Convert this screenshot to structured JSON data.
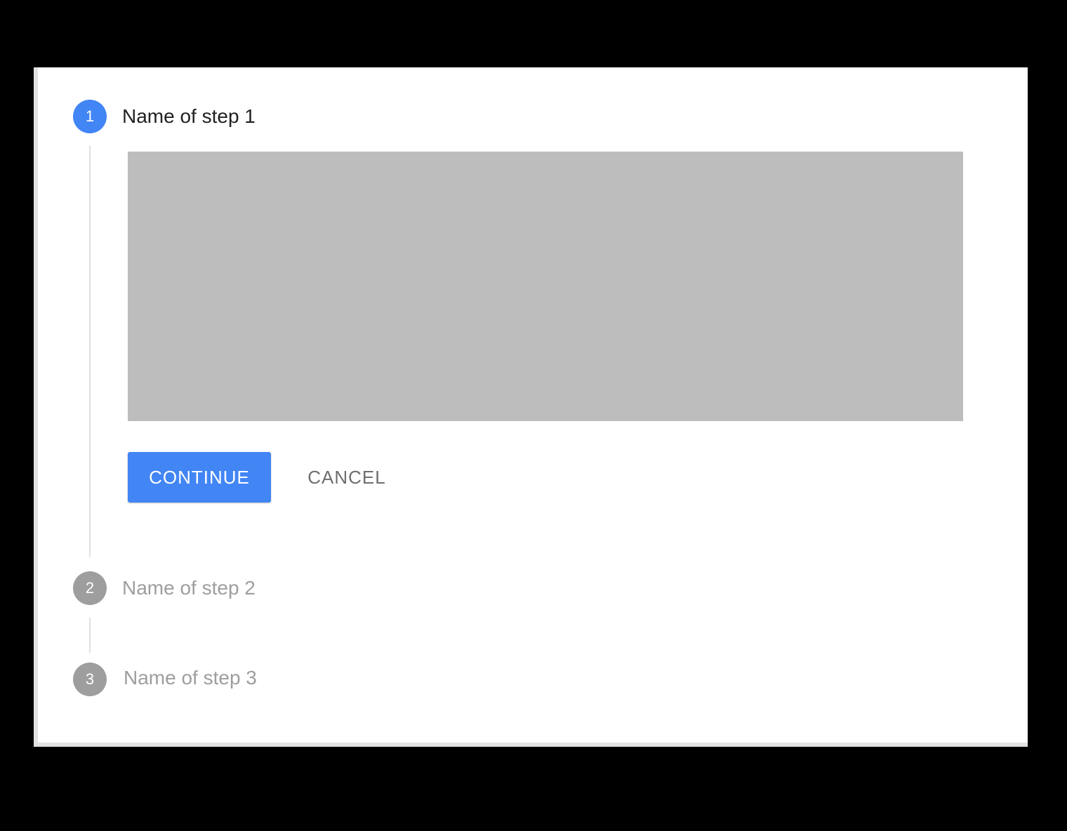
{
  "stepper": {
    "steps": [
      {
        "number": "1",
        "label": "Name of step 1",
        "state": "active"
      },
      {
        "number": "2",
        "label": "Name of step 2",
        "state": "inactive"
      },
      {
        "number": "3",
        "label": "Name of step 3",
        "state": "inactive"
      }
    ],
    "actions": {
      "continue_label": "CONTINUE",
      "cancel_label": "CANCEL"
    }
  },
  "colors": {
    "active": "#4285f4",
    "inactive": "#9e9e9e",
    "placeholder": "#bdbdbd",
    "background": "#000000"
  }
}
